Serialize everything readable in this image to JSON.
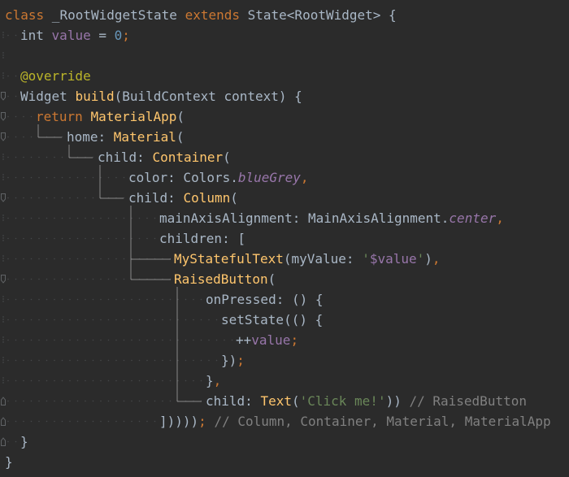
{
  "editor": {
    "theme_colors": {
      "background": "#2b2b2b",
      "keyword": "#cc7832",
      "plain": "#a9b7c6",
      "field": "#9876aa",
      "number": "#6897bb",
      "method": "#ffc66d",
      "string": "#6a8759",
      "annotation": "#bbb529",
      "comment": "#808080"
    },
    "lines": [
      {
        "tokens": [
          {
            "t": "class",
            "k": "keyword"
          },
          {
            "t": " _RootWidgetState ",
            "k": "plain"
          },
          {
            "t": "extends",
            "k": "keyword"
          },
          {
            "t": " State<RootWidget> {",
            "k": "plain"
          }
        ]
      },
      {
        "tokens": [
          {
            "t": "int",
            "k": "plain"
          },
          {
            "t": " ",
            "k": "plain"
          },
          {
            "t": "value",
            "k": "field"
          },
          {
            "t": " = ",
            "k": "plain"
          },
          {
            "t": "0",
            "k": "number"
          },
          {
            "t": ";",
            "k": "punct"
          }
        ]
      },
      {
        "tokens": []
      },
      {
        "tokens": [
          {
            "t": "@override",
            "k": "annot"
          }
        ]
      },
      {
        "tokens": [
          {
            "t": "Widget ",
            "k": "plain"
          },
          {
            "t": "build",
            "k": "method"
          },
          {
            "t": "(BuildContext context) {",
            "k": "plain"
          }
        ]
      },
      {
        "tokens": [
          {
            "t": "return",
            "k": "keyword"
          },
          {
            "t": " ",
            "k": "plain"
          },
          {
            "t": "MaterialApp",
            "k": "method"
          },
          {
            "t": "(",
            "k": "plain"
          }
        ]
      },
      {
        "tokens": [
          {
            "t": "home: ",
            "k": "plain"
          },
          {
            "t": "Material",
            "k": "method"
          },
          {
            "t": "(",
            "k": "plain"
          }
        ]
      },
      {
        "tokens": [
          {
            "t": "child: ",
            "k": "plain"
          },
          {
            "t": "Container",
            "k": "method"
          },
          {
            "t": "(",
            "k": "plain"
          }
        ]
      },
      {
        "tokens": [
          {
            "t": "color: Colors.",
            "k": "plain"
          },
          {
            "t": "blueGrey",
            "k": "fieldit"
          },
          {
            "t": ",",
            "k": "punct"
          }
        ]
      },
      {
        "tokens": [
          {
            "t": "child: ",
            "k": "plain"
          },
          {
            "t": "Column",
            "k": "method"
          },
          {
            "t": "(",
            "k": "plain"
          }
        ]
      },
      {
        "tokens": [
          {
            "t": "mainAxisAlignment: MainAxisAlignment.",
            "k": "plain"
          },
          {
            "t": "center",
            "k": "fieldit"
          },
          {
            "t": ",",
            "k": "punct"
          }
        ]
      },
      {
        "tokens": [
          {
            "t": "children: [",
            "k": "plain"
          }
        ]
      },
      {
        "tokens": [
          {
            "t": "MyStatefulText",
            "k": "method"
          },
          {
            "t": "(myValue: ",
            "k": "plain"
          },
          {
            "t": "'",
            "k": "string"
          },
          {
            "t": "$value",
            "k": "field"
          },
          {
            "t": "'",
            "k": "string"
          },
          {
            "t": ")",
            "k": "plain"
          },
          {
            "t": ",",
            "k": "punct"
          }
        ]
      },
      {
        "tokens": [
          {
            "t": "RaisedButton",
            "k": "method"
          },
          {
            "t": "(",
            "k": "plain"
          }
        ]
      },
      {
        "tokens": [
          {
            "t": "onPressed: () {",
            "k": "plain"
          }
        ]
      },
      {
        "tokens": [
          {
            "t": "setState(() {",
            "k": "plain"
          }
        ]
      },
      {
        "tokens": [
          {
            "t": "++",
            "k": "plain"
          },
          {
            "t": "value",
            "k": "field"
          },
          {
            "t": ";",
            "k": "punct"
          }
        ]
      },
      {
        "tokens": [
          {
            "t": "})",
            "k": "plain"
          },
          {
            "t": ";",
            "k": "punct"
          }
        ]
      },
      {
        "tokens": [
          {
            "t": "}",
            "k": "plain"
          },
          {
            "t": ",",
            "k": "punct"
          }
        ]
      },
      {
        "tokens": [
          {
            "t": "child: ",
            "k": "plain"
          },
          {
            "t": "Text",
            "k": "method"
          },
          {
            "t": "(",
            "k": "plain"
          },
          {
            "t": "'Click me!'",
            "k": "string"
          },
          {
            "t": ")) ",
            "k": "plain"
          },
          {
            "t": "// RaisedButton",
            "k": "comment"
          }
        ]
      },
      {
        "tokens": [
          {
            "t": "]))))",
            "k": "plain"
          },
          {
            "t": ";",
            "k": "punct"
          },
          {
            "t": " // Column, Container, Material, MaterialApp",
            "k": "comment"
          }
        ]
      },
      {
        "tokens": [
          {
            "t": "}",
            "k": "plain"
          }
        ]
      },
      {
        "tokens": [
          {
            "t": "}",
            "k": "plain"
          }
        ]
      }
    ]
  }
}
